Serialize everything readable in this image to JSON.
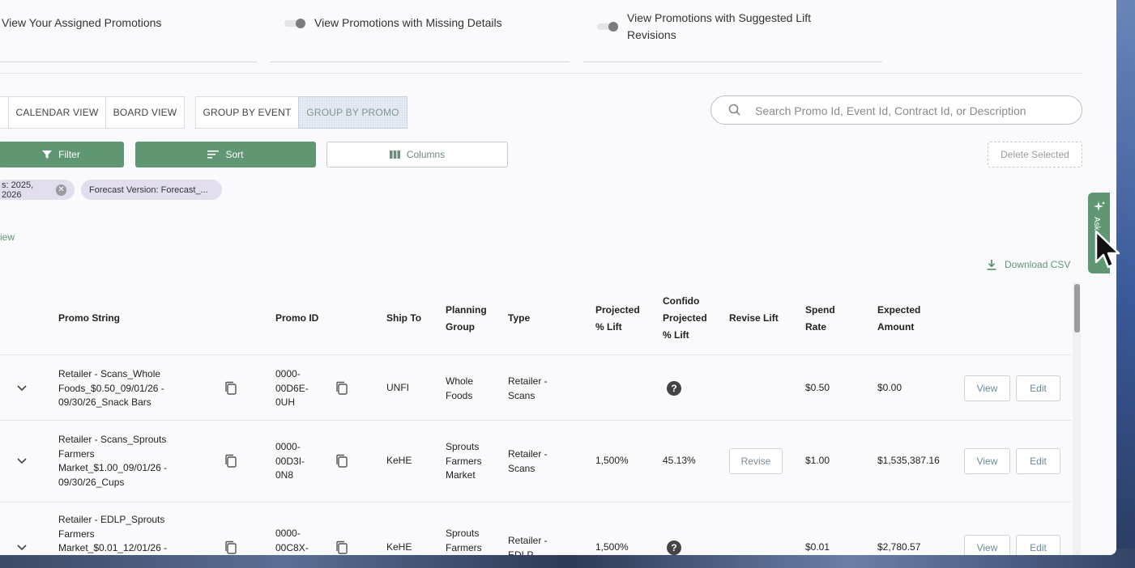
{
  "filters_bar": {
    "assigned_label": "View Your Assigned Promotions",
    "missing_label": "View Promotions with Missing Details",
    "suggested_label_line1": "View Promotions with Suggested Lift",
    "suggested_label_line2": "Revisions"
  },
  "view_toggle": {
    "calendar": "CALENDAR VIEW",
    "board": "BOARD VIEW",
    "group_event": "GROUP BY EVENT",
    "group_promo": "GROUP BY PROMO"
  },
  "search": {
    "placeholder": "Search Promo Id, Event Id, Contract Id, or Description"
  },
  "toolbar": {
    "filter": "Filter",
    "sort": "Sort",
    "columns": "Columns",
    "delete_selected": "Delete Selected"
  },
  "chips": [
    {
      "label": "s: 2025, 2026"
    },
    {
      "label": "Forecast Version: Forecast_..."
    }
  ],
  "view_link": "iew",
  "download_csv": "Download CSV",
  "ask_tab": "Ask",
  "table": {
    "headers": {
      "promo_string": "Promo String",
      "promo_id": "Promo ID",
      "ship_to": "Ship To",
      "planning_group_1": "Planning",
      "planning_group_2": "Group",
      "type": "Type",
      "proj_lift_1": "Projected",
      "proj_lift_2": "% Lift",
      "confido_1": "Confido",
      "confido_2": "Projected",
      "confido_3": "% Lift",
      "revise_lift": "Revise Lift",
      "spend_rate_1": "Spend",
      "spend_rate_2": "Rate",
      "expected_1": "Expected",
      "expected_2": "Amount"
    },
    "rows": [
      {
        "promo_string": [
          "Retailer - Scans_Whole",
          "Foods_$0.50_09/01/26 -",
          "09/30/26_Snack Bars"
        ],
        "promo_id": [
          "0000-",
          "00D6E-",
          "0UH"
        ],
        "ship_to": "UNFI",
        "planning_group": [
          "Whole",
          "Foods"
        ],
        "type": [
          "Retailer -",
          "Scans"
        ],
        "proj_lift": "",
        "confido": "?",
        "revise": "",
        "spend_rate": "$0.50",
        "expected": "$0.00",
        "view": "View",
        "edit": "Edit"
      },
      {
        "promo_string": [
          "Retailer - Scans_Sprouts",
          "Farmers",
          "Market_$1.00_09/01/26 -",
          "09/30/26_Cups"
        ],
        "promo_id": [
          "0000-",
          "00D3I-",
          "0N8"
        ],
        "ship_to": "KeHE",
        "planning_group": [
          "Sprouts",
          "Farmers",
          "Market"
        ],
        "type": [
          "Retailer -",
          "Scans"
        ],
        "proj_lift": "1,500%",
        "confido": "45.13%",
        "revise": "Revise",
        "spend_rate": "$1.00",
        "expected": "$1,535,387.16",
        "view": "View",
        "edit": "Edit"
      },
      {
        "promo_string": [
          "Retailer - EDLP_Sprouts",
          "Farmers",
          "Market_$0.01_12/01/26 -"
        ],
        "promo_id": [
          "0000-",
          "00C8X-"
        ],
        "ship_to": "KeHE",
        "planning_group": [
          "Sprouts",
          "Farmers"
        ],
        "type": [
          "Retailer -",
          "EDLP"
        ],
        "proj_lift": "1,500%",
        "confido": "?",
        "revise": "",
        "spend_rate": "$0.01",
        "expected": "$2,780.57",
        "view": "View",
        "edit": "Edit"
      }
    ]
  }
}
